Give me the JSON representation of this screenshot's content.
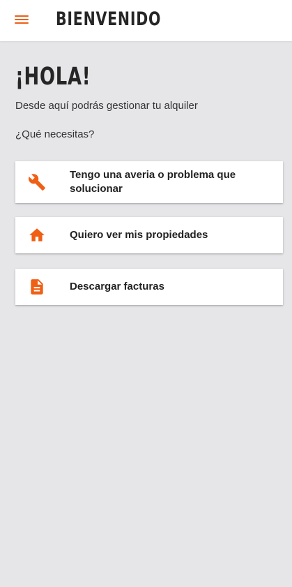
{
  "header": {
    "title": "BIENVENIDO",
    "menu_icon": "hamburger-menu-icon"
  },
  "main": {
    "greeting": "¡HOLA!",
    "subtitle": "Desde aquí podrás gestionar tu alquiler",
    "question": "¿Qué necesitas?",
    "options": [
      {
        "label": "Tengo una averia o problema que solucionar",
        "icon": "wrench-icon"
      },
      {
        "label": "Quiero ver mis propiedades",
        "icon": "home-icon"
      },
      {
        "label": "Descargar facturas",
        "icon": "document-icon"
      }
    ]
  },
  "colors": {
    "accent": "#ef5f14",
    "background": "#e6e5e8",
    "card": "#ffffff",
    "text": "#262626"
  }
}
